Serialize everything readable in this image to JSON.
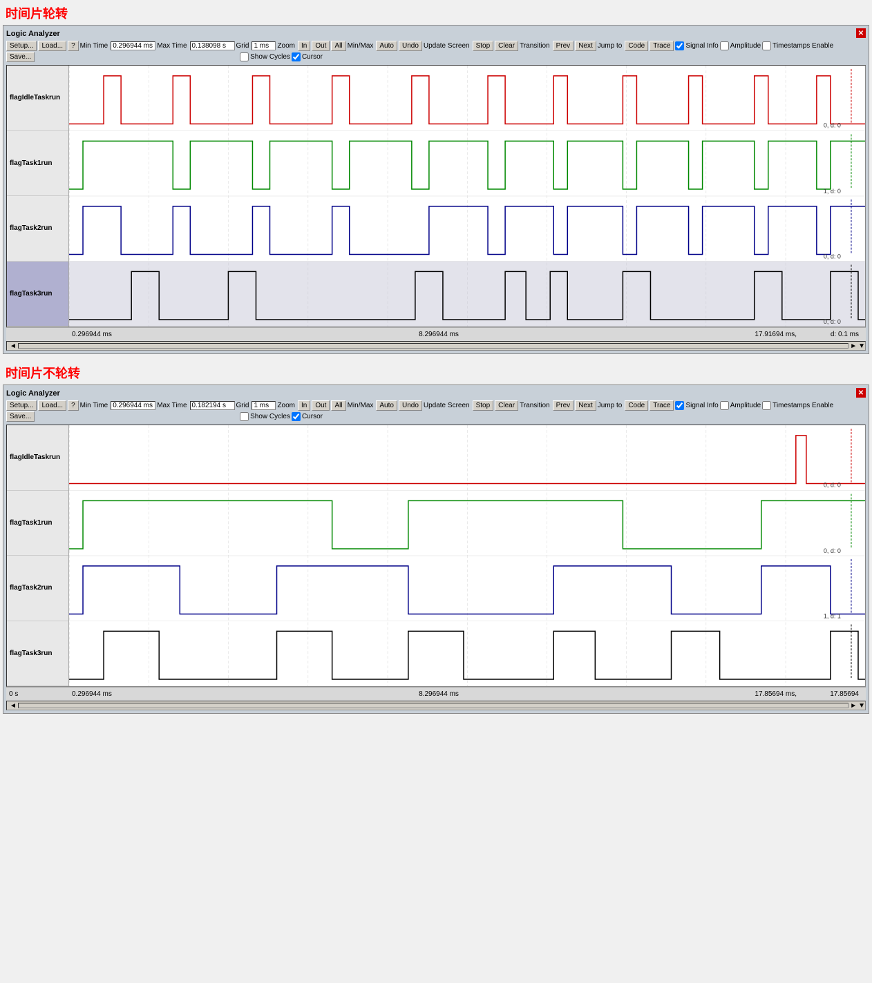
{
  "section1": {
    "title": "时间片轮转",
    "analyzer": {
      "title": "Logic Analyzer",
      "toolbar": {
        "setup": "Setup...",
        "load": "Load...",
        "save": "Save...",
        "help": "?",
        "minTimeLabel": "Min Time",
        "maxTimeLabel": "Max Time",
        "gridLabel": "Grid",
        "minTimeValue": "0.296944 ms",
        "maxTimeValue": "0.138098 s",
        "gridValue": "1 ms",
        "zoomLabel": "Zoom",
        "zoomIn": "In",
        "zoomOut": "Out",
        "zoomAll": "All",
        "minMaxLabel": "Min/Max",
        "minMaxAuto": "Auto",
        "minMaxUndo": "Undo",
        "updateLabel": "Update Screen",
        "updateStop": "Stop",
        "updateClear": "Clear",
        "transLabel": "Transition",
        "transPrev": "Prev",
        "transNext": "Next",
        "jumpLabel": "Jump to",
        "jumpCode": "Code",
        "jumpTrace": "Trace",
        "signalInfo": "Signal Info",
        "showCycles": "Show Cycles",
        "amplitude": "Amplitude",
        "cursor": "Cursor",
        "timestampsEnable": "Timestamps Enable"
      },
      "signals": [
        {
          "name": "flagIdleTaskrun",
          "color": "#cc0000",
          "highlighted": false
        },
        {
          "name": "flagTask1run",
          "color": "#008800",
          "highlighted": false
        },
        {
          "name": "flagTask2run",
          "color": "#000088",
          "highlighted": false
        },
        {
          "name": "flagTask3run",
          "color": "#000000",
          "highlighted": true
        }
      ],
      "timeline": {
        "left": "0.296944 ms",
        "mid": "8.296944 ms",
        "right": "17.91694 ms,",
        "suffix": "d: 0.1 ms"
      }
    }
  },
  "section2": {
    "title": "时间片不轮转",
    "analyzer": {
      "title": "Logic Analyzer",
      "toolbar": {
        "setup": "Setup...",
        "load": "Load...",
        "save": "Save...",
        "help": "?",
        "minTimeLabel": "Min Time",
        "maxTimeLabel": "Max Time",
        "gridLabel": "Grid",
        "minTimeValue": "0.296944 ms",
        "maxTimeValue": "0.182194 s",
        "gridValue": "1 ms",
        "zoomLabel": "Zoom",
        "zoomIn": "In",
        "zoomOut": "Out",
        "zoomAll": "All",
        "minMaxLabel": "Min/Max",
        "minMaxAuto": "Auto",
        "minMaxUndo": "Undo",
        "updateLabel": "Update Screen",
        "updateStop": "Stop",
        "updateClear": "Clear",
        "transLabel": "Transition",
        "transPrev": "Prev",
        "transNext": "Next",
        "jumpLabel": "Jump to",
        "jumpCode": "Code",
        "jumpTrace": "Trace",
        "signalInfo": "Signal Info",
        "showCycles": "Show Cycles",
        "amplitude": "Amplitude",
        "cursor": "Cursor",
        "timestampsEnable": "Timestamps Enable"
      },
      "signals": [
        {
          "name": "flagIdleTaskrun",
          "color": "#cc0000",
          "highlighted": false
        },
        {
          "name": "flagTask1run",
          "color": "#008800",
          "highlighted": false
        },
        {
          "name": "flagTask2run",
          "color": "#000088",
          "highlighted": false
        },
        {
          "name": "flagTask3run",
          "color": "#000000",
          "highlighted": false
        }
      ],
      "timeline": {
        "left": "0.296944 ms",
        "mid": "8.296944 ms",
        "right": "17.85694 ms,",
        "suffix": "17.85694"
      }
    }
  }
}
